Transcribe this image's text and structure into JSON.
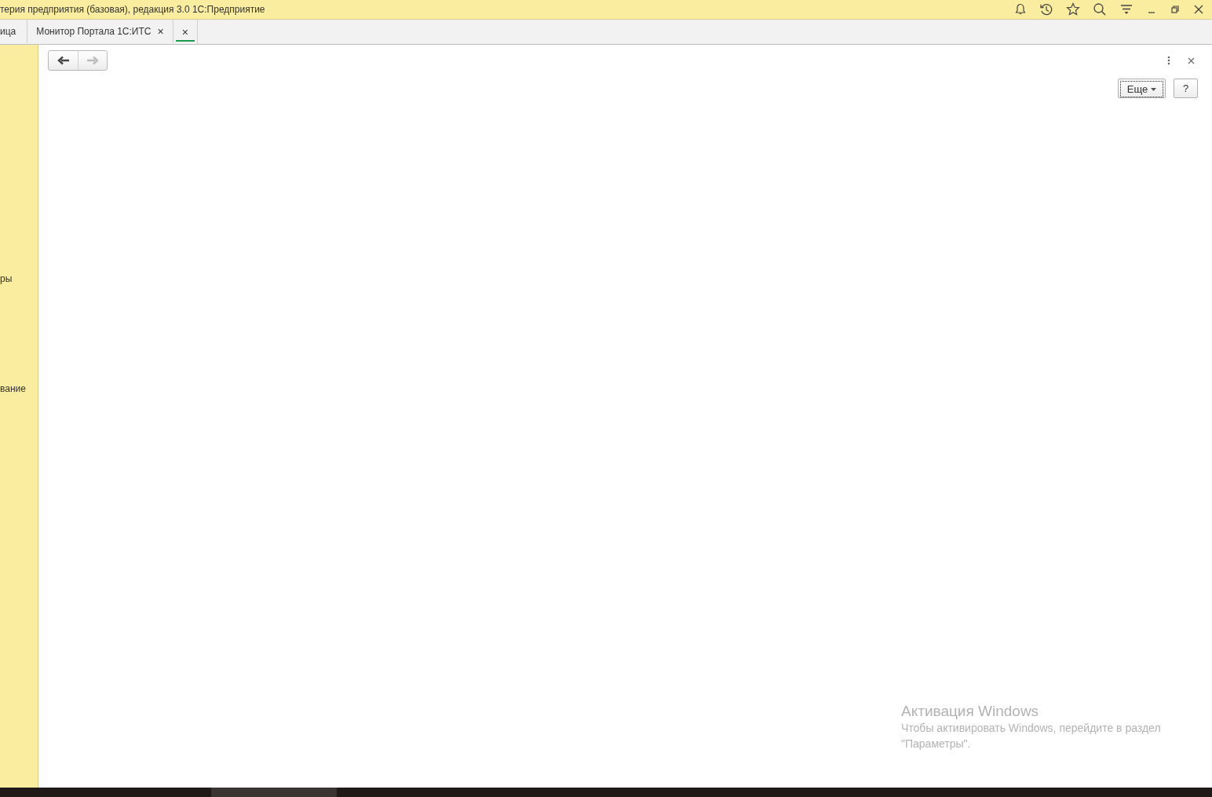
{
  "window": {
    "title": "терия предприятия (базовая), редакция 3.0 1С:Предприятие"
  },
  "tabs": [
    {
      "label": "ица",
      "selected": false
    },
    {
      "label": "Монитор Портала 1С:ИТС",
      "close": "×",
      "selected": false
    },
    {
      "close": "×",
      "selected": true
    }
  ],
  "sidebar": {
    "items": [
      {
        "label": "ры"
      },
      {
        "label": "вание"
      }
    ]
  },
  "navigation": {
    "back": {
      "disabled": false
    },
    "forward": {
      "disabled": true
    }
  },
  "form": {
    "more_button": "Еще",
    "help_button": "?"
  },
  "activation_notice": {
    "title": "Активация Windows",
    "text": "Чтобы активировать Windows, перейдите в раздел \"Параметры\"."
  }
}
